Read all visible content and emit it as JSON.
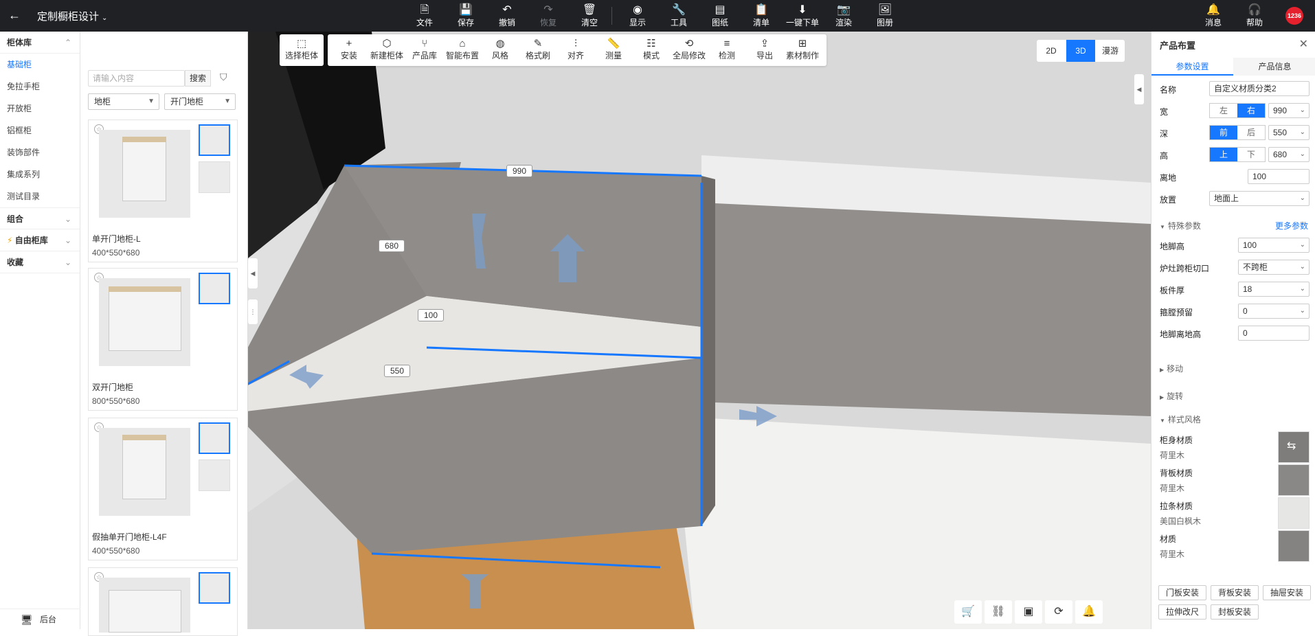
{
  "header": {
    "back": "←",
    "title": "定制橱柜设计",
    "title_caret": "⌄",
    "tools": [
      {
        "label": "文件",
        "icon": "file-icon",
        "glyph": "🗎",
        "disabled": false
      },
      {
        "label": "保存",
        "icon": "save-icon",
        "glyph": "💾",
        "disabled": false
      },
      {
        "label": "撤销",
        "icon": "undo-icon",
        "glyph": "↶",
        "disabled": false
      },
      {
        "label": "恢复",
        "icon": "redo-icon",
        "glyph": "↷",
        "disabled": true
      },
      {
        "label": "清空",
        "icon": "clear-icon",
        "glyph": "🗑",
        "disabled": false
      },
      {
        "label": "显示",
        "icon": "eye-icon",
        "glyph": "◉",
        "disabled": false
      },
      {
        "label": "工具",
        "icon": "wrench-icon",
        "glyph": "🔧",
        "disabled": false
      },
      {
        "label": "图纸",
        "icon": "map-icon",
        "glyph": "▤",
        "disabled": false
      },
      {
        "label": "清单",
        "icon": "clipboard-icon",
        "glyph": "📋",
        "disabled": false
      },
      {
        "label": "一键下单",
        "icon": "order-icon",
        "glyph": "⬇",
        "disabled": false
      },
      {
        "label": "渲染",
        "icon": "camera-icon",
        "glyph": "📷",
        "disabled": false
      },
      {
        "label": "图册",
        "icon": "album-icon",
        "glyph": "🖼",
        "disabled": false
      }
    ],
    "messages": "消息",
    "help": "帮助",
    "avatar_text": "1236"
  },
  "categories": {
    "library_title": "柜体库",
    "items": [
      "基础柜",
      "免拉手柜",
      "开放柜",
      "铝框柜",
      "装饰部件",
      "集成系列",
      "测试目录"
    ],
    "active_index": 0,
    "group": "组合",
    "free_library": "自由柜库",
    "favorites": "收藏",
    "backend": "后台"
  },
  "products": {
    "search_placeholder": "请输入内容",
    "search_button": "搜索",
    "filter1": "地柜",
    "filter2": "开门地柜",
    "items": [
      {
        "name": "单开门地柜-L",
        "size": "400*550*680"
      },
      {
        "name": "双开门地柜",
        "size": "800*550*680"
      },
      {
        "name": "假抽单开门地柜-L4F",
        "size": "400*550*680"
      }
    ]
  },
  "viewport": {
    "tool_select": "选择柜体",
    "tools": [
      "安装",
      "新建柜体",
      "产品库",
      "智能布置",
      "风格",
      "格式刷",
      "对齐",
      "测量",
      "模式",
      "全局修改",
      "检测",
      "导出",
      "素材制作"
    ],
    "view_modes": [
      "2D",
      "3D",
      "漫游"
    ],
    "active_view": "3D",
    "dimensions": {
      "width": "990",
      "height": "680",
      "offset": "100",
      "depth": "550"
    }
  },
  "properties": {
    "title": "产品布置",
    "tabs": [
      "参数设置",
      "产品信息"
    ],
    "name_label": "名称",
    "name_value": "自定义材质分类2",
    "width_label": "宽",
    "width_left": "左",
    "width_right": "右",
    "width_value": "990",
    "depth_label": "深",
    "depth_front": "前",
    "depth_back": "后",
    "depth_value": "550",
    "height_label": "高",
    "height_up": "上",
    "height_down": "下",
    "height_value": "680",
    "ground_label": "离地",
    "ground_value": "100",
    "place_label": "放置",
    "place_value": "地面上",
    "special_section": "特殊参数",
    "more_params": "更多参数",
    "special": [
      {
        "label": "地脚高",
        "value": "100",
        "dropdown": true
      },
      {
        "label": "炉灶跨柜切口",
        "value": "不跨柜",
        "dropdown": true
      },
      {
        "label": "板件厚",
        "value": "18",
        "dropdown": true
      },
      {
        "label": "箍膛预留",
        "value": "0",
        "dropdown": true
      },
      {
        "label": "地脚离地高",
        "value": "0",
        "dropdown": false
      }
    ],
    "move_section": "移动",
    "rotate_section": "旋转",
    "style_section": "样式风格",
    "materials": [
      {
        "label": "柜身材质",
        "value": "荷里木",
        "color": "#7f7d7b"
      },
      {
        "label": "背板材质",
        "value": "荷里木",
        "color": "#8a8886"
      },
      {
        "label": "拉条材质",
        "value": "美国白枫木",
        "color": "#e6e6e4"
      },
      {
        "label": "材质",
        "value": "荷里木",
        "color": "#858381"
      }
    ],
    "actions": [
      "门板安装",
      "背板安装",
      "抽屉安装",
      "拉伸改尺",
      "封板安装"
    ]
  },
  "colors": {
    "accent": "#1677ff",
    "topbar": "#1f2125",
    "badge": "#e5212d"
  }
}
